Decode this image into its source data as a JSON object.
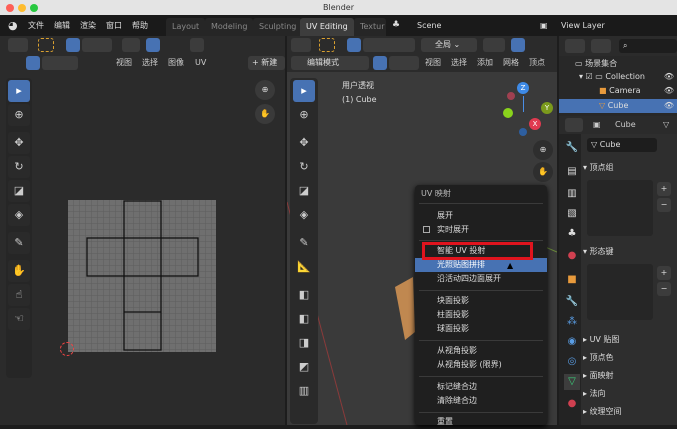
{
  "window": {
    "title": "Blender"
  },
  "menubar": {
    "items": [
      "文件",
      "编辑",
      "渲染",
      "窗口",
      "帮助"
    ]
  },
  "workspace_tabs": [
    "Layout",
    "Modeling",
    "Sculpting",
    "UV Editing",
    "Textur"
  ],
  "active_tab": "UV Editing",
  "scene": {
    "name": "Scene",
    "view_layer": "View Layer"
  },
  "uv_editor": {
    "menus": [
      "视图",
      "选择",
      "图像",
      "UV"
    ],
    "new_label": "新建"
  },
  "viewport": {
    "mode": "编辑模式",
    "transform": "全局",
    "menus": [
      "视图",
      "选择",
      "添加",
      "网格",
      "顶点"
    ],
    "view_name": "用户透视",
    "object_label": "(1) Cube"
  },
  "gizmo": {
    "z": "Z",
    "y": "Y",
    "x": "X"
  },
  "uv_menu": {
    "title": "UV 映射",
    "items": [
      {
        "label": "展开"
      },
      {
        "label": "实时展开",
        "checkbox": true
      },
      {
        "label": "智能 UV 投射",
        "boxed": true
      },
      {
        "label": "光照贴图拼排",
        "highlighted": true
      },
      {
        "label": "沿活动四边面展开"
      },
      {
        "label": "块面投影"
      },
      {
        "label": "柱面投影"
      },
      {
        "label": "球面投影"
      },
      {
        "label": "从视角投影"
      },
      {
        "label": "从视角投影 (限界)"
      },
      {
        "label": "标记缝合边"
      },
      {
        "label": "清除缝合边"
      },
      {
        "label": "重置"
      }
    ]
  },
  "outliner": {
    "root": "场景集合",
    "items": [
      "Collection",
      "Camera",
      "Cube"
    ],
    "selected": "Cube"
  },
  "properties": {
    "object": "Cube",
    "mesh": "Cube",
    "panels": [
      "顶点组",
      "形态键",
      "UV 贴图",
      "顶点色",
      "面映射",
      "法向",
      "纹理空间"
    ]
  },
  "colors": {
    "accent": "#4772b3",
    "highlight_box": "#e0141e"
  }
}
